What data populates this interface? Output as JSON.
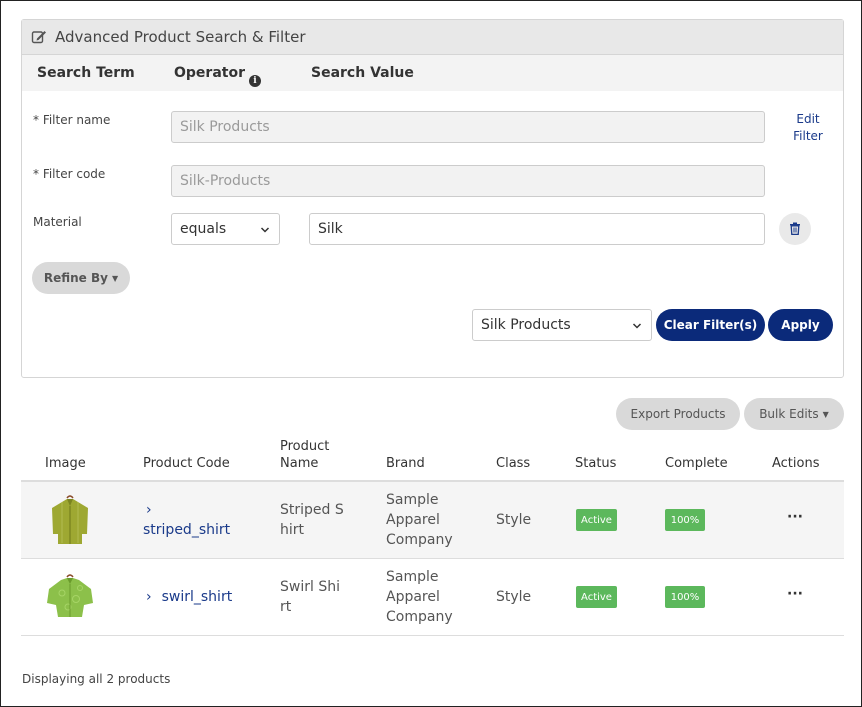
{
  "panel": {
    "title": "Advanced Product Search & Filter",
    "columns": {
      "search_term": "Search Term",
      "operator": "Operator",
      "search_value": "Search Value"
    },
    "filter_name": {
      "label": "* Filter name",
      "value": "Silk Products"
    },
    "filter_code": {
      "label": "* Filter code",
      "value": "Silk-Products"
    },
    "edit_filter_lines": [
      "Edit",
      "Filter"
    ],
    "material_row": {
      "label": "Material",
      "operator": "equals",
      "value": "Silk"
    },
    "refine_by": "Refine By",
    "saved_filter": "Silk Products",
    "clear_filters": "Clear Filter(s)",
    "apply": "Apply"
  },
  "toolbar": {
    "export": "Export Products",
    "bulk_edits": "Bulk Edits"
  },
  "table": {
    "headers": {
      "image": "Image",
      "product_code": "Product Code",
      "product_name_lines": [
        "Product",
        "Name"
      ],
      "brand": "Brand",
      "class": "Class",
      "status": "Status",
      "complete": "Complete",
      "actions": "Actions"
    },
    "rows": [
      {
        "chevron": "›",
        "code": "striped_shirt",
        "name_lines": [
          "Striped S",
          "hirt"
        ],
        "brand_lines": [
          "Sample",
          "Apparel",
          "Company"
        ],
        "class": "Style",
        "status": "Active",
        "complete": "100%",
        "actions": "···"
      },
      {
        "chevron": "›",
        "code": "swirl_shirt",
        "name_lines": [
          "Swirl Shi",
          "rt"
        ],
        "brand_lines": [
          "Sample",
          "Apparel",
          "Company"
        ],
        "class": "Style",
        "status": "Active",
        "complete": "100%",
        "actions": "···"
      }
    ]
  },
  "footer": {
    "prefix": "Displaying ",
    "all": "all",
    "count": "2",
    "suffix": " products"
  },
  "colors": {
    "navy": "#0b2a7a",
    "success": "#5cb85c",
    "link": "#1a3a8a"
  },
  "icons": [
    "edit-icon",
    "info-icon",
    "chevron-down-icon",
    "trash-icon",
    "caret-down-icon",
    "chevron-right-icon",
    "more-icon",
    "shirt-thumbnail"
  ]
}
